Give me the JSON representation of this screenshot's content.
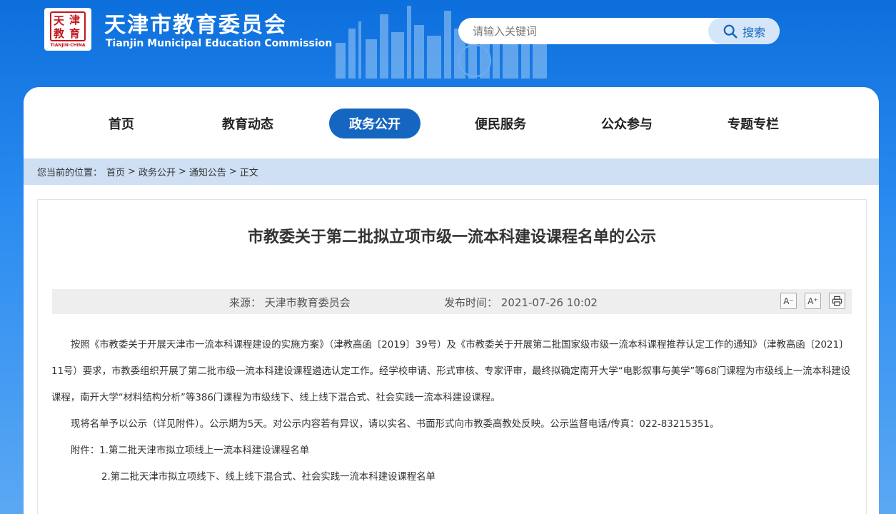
{
  "header": {
    "logo_chars": [
      "天",
      "津",
      "教",
      "育"
    ],
    "logo_caption": "TIANJIN·CHINA",
    "title": "天津市教育委员会",
    "subtitle": "Tianjin Municipal Education Commission",
    "search": {
      "placeholder": "请输入关键词",
      "button_label": "搜索"
    }
  },
  "nav": {
    "items": [
      {
        "label": "首页"
      },
      {
        "label": "教育动态"
      },
      {
        "label": "政务公开",
        "active": true
      },
      {
        "label": "便民服务"
      },
      {
        "label": "公众参与"
      },
      {
        "label": "专题专栏"
      }
    ]
  },
  "breadcrumb": {
    "prefix": "您当前的位置：",
    "items": [
      "首页",
      "政务公开",
      "通知公告",
      "正文"
    ],
    "separator": ">"
  },
  "article": {
    "title": "市教委关于第二批拟立项市级一流本科建设课程名单的公示",
    "source_label": "来源：",
    "source": "天津市教育委员会",
    "time_label": "发布时间：",
    "time": "2021-07-26 10:02",
    "tools": {
      "font_smaller": "A⁻",
      "font_larger": "A⁺",
      "print_icon": "printer-icon"
    },
    "paragraphs": [
      "按照《市教委关于开展天津市一流本科课程建设的实施方案》（津教高函〔2019〕39号）及《市教委关于开展第二批国家级市级一流本科课程推荐认定工作的通知》（津教高函〔2021〕11号）要求，市教委组织开展了第二批市级一流本科建设课程遴选认定工作。经学校申请、形式审核、专家评审，最终拟确定南开大学“电影叙事与美学”等68门课程为市级线上一流本科建设课程，南开大学“材料结构分析”等386门课程为市级线下、线上线下混合式、社会实践一流本科建设课程。",
      "现将名单予以公示（详见附件）。公示期为5天。对公示内容若有异议，请以实名、书面形式向市教委高教处反映。公示监督电话/传真：022-83215351。",
      "附件：1.第二批天津市拟立项线上一流本科建设课程名单"
    ],
    "attachment2": "2.第二批天津市拟立项线下、线上线下混合式、社会实践一流本科建设课程名单"
  },
  "colors": {
    "brand_blue": "#1566c0",
    "header_blue": "#1a78e0",
    "breadcrumb_bg": "#cfe0f4",
    "logo_red": "#c4161c"
  }
}
